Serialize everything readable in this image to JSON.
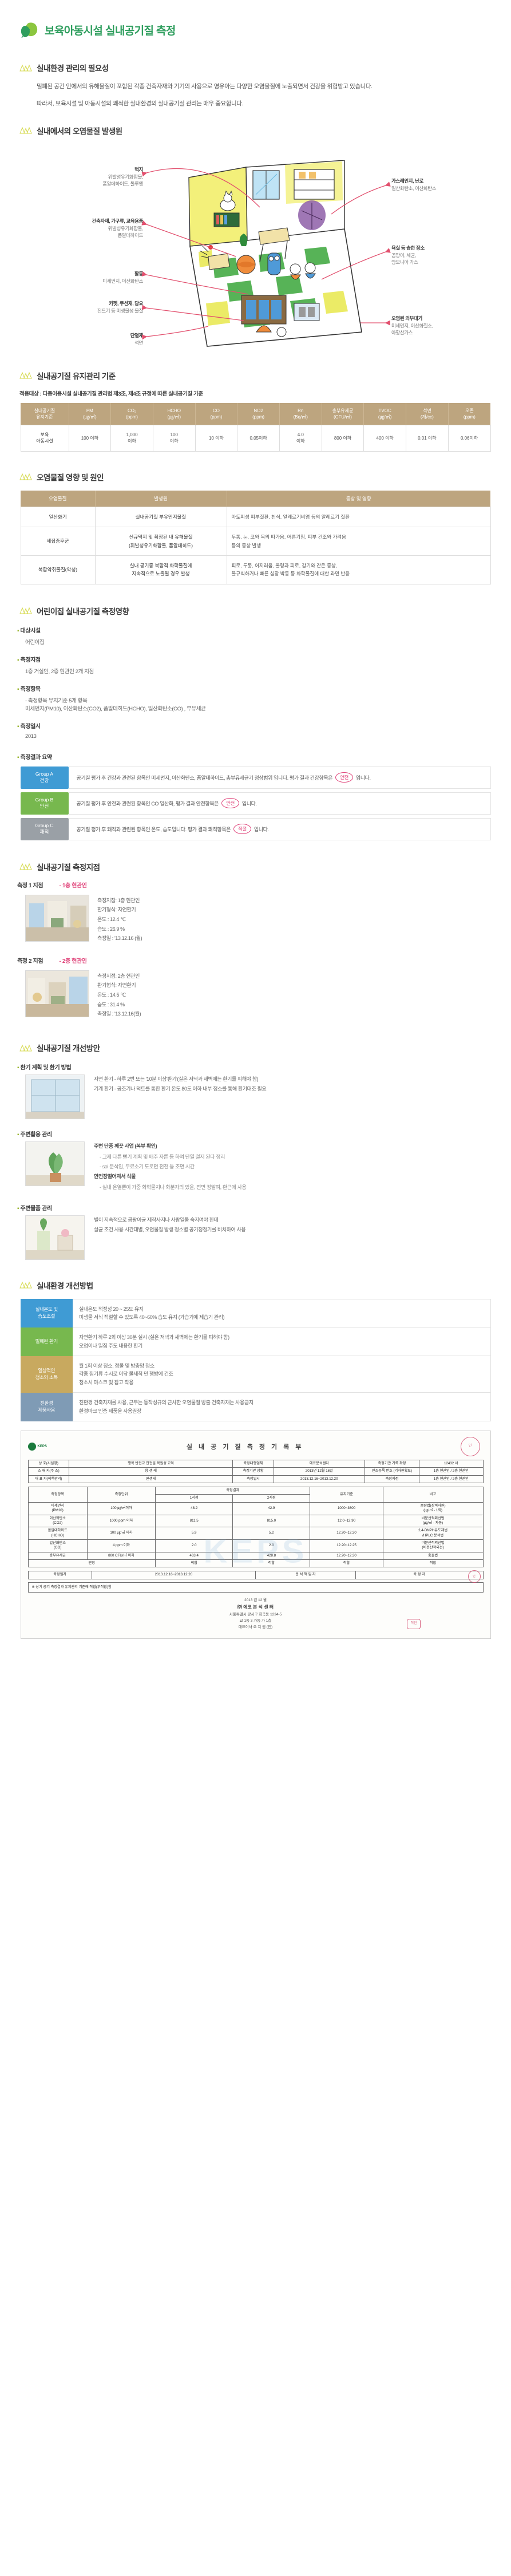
{
  "header": {
    "title": "보육아동시설 실내공기질 측정",
    "logo_icon": "leaf-logo"
  },
  "sections": {
    "necessity": {
      "title": "실내환경 관리의 필요성",
      "paragraphs": [
        "밀폐된 공간 안에서의 유해물질이 포함된 각종 건축자재와 기기의 사용으로 영유아는 다양한 오염물질에 노출되면서 건강을 위협받고 있습니다.",
        "따라서, 보육시설 및 아동시설의 쾌적한 실내환경의 실내공기질 관리는 매우 중요합니다."
      ]
    },
    "sources": {
      "title": "실내에서의 오염물질 발생원",
      "labels": [
        {
          "title": "벽지",
          "desc": "위발성유기화합물,\n폼알데하이드, 톨루엔"
        },
        {
          "title": "건축자재, 가구류, 교육용품",
          "desc": "위발성유기화합물,\n폼알데하이드"
        },
        {
          "title": "활동",
          "desc": "미세먼지, 이산화탄소"
        },
        {
          "title": "카펫, 쿠션재, 담요",
          "desc": "진드기 등 미생물성 물질"
        },
        {
          "title": "단열재",
          "desc": "석면"
        },
        {
          "title": "가스레인지, 난로",
          "desc": "일산화탄소, 이산화탄소"
        },
        {
          "title": "욕실 등 습한 장소",
          "desc": "곰팡이, 세균,\n암모니아 가스"
        },
        {
          "title": "오염된 외부대기",
          "desc": "미세먼지, 이산화질소,\n아황산가스"
        }
      ]
    },
    "standards": {
      "title": "실내공기질 유지관리 기준",
      "note": "적용대상 : 다중이용시설 실내공기질 관리법 제3조, 제4조 규정에 따른 실내공기질 기준",
      "columns": [
        {
          "name": "실내공기질\n유지기준",
          "unit": ""
        },
        {
          "name": "PM",
          "unit": "(㎍/㎥)"
        },
        {
          "name": "CO₂",
          "unit": "(ppm)"
        },
        {
          "name": "HCHO",
          "unit": "(㎍/㎥)"
        },
        {
          "name": "CO",
          "unit": "(ppm)"
        },
        {
          "name": "NO2",
          "unit": "(ppm)"
        },
        {
          "name": "Rn",
          "unit": "(Bq/㎥)"
        },
        {
          "name": "총부유세균",
          "unit": "(CFU/㎥)"
        },
        {
          "name": "TVOC",
          "unit": "(㎍/㎥)"
        },
        {
          "name": "석면",
          "unit": "(개/cc)"
        },
        {
          "name": "오존",
          "unit": "(ppm)"
        }
      ],
      "rows": [
        {
          "label": "보육\n아동시설",
          "values": [
            "100 이하",
            "1,000\n이하",
            "100\n이하",
            "10 이하",
            "0.05이하",
            "4.0\n이하",
            "800 이하",
            "400 이하",
            "0.01 이하",
            "0.06이하"
          ]
        }
      ]
    },
    "cause": {
      "title": "오염물질 영향 및 원인",
      "columns": [
        "오염물질",
        "발생원",
        "증상 및 영향"
      ],
      "rows": [
        {
          "name": "일산화기",
          "source": "실내공기질 부유먼지물질",
          "effect": "아토피성 피부질환, 천식, 알레르기비염 등의 알레르기 질환"
        },
        {
          "name": "세집증후군",
          "source": "신규택지 및 확장된 내 유해물질\n(휘발성유기화합물, 폼알데히드)",
          "effect": "두통, 눈, 코와 목의 따가움, 어른기침, 피부 건조와 가려움\n등의 증상 발생"
        },
        {
          "name": "복합악취물질(악성)",
          "source": "실내 공기중 복합적 화학물질에\n지속적으로 노출될 경우 발생",
          "effect": "피로, 두통, 어지러움, 울렁과 피로, 감기와 같은 증상,\n불규칙하거나 빠른 심장 박동 등 화학물질에 대한 과민 반응"
        }
      ]
    },
    "measurement_target": {
      "title": "어린이집 실내공기질 측정영향",
      "items": [
        {
          "label": "대상시설",
          "value": "어린이집"
        },
        {
          "label": "측정지점",
          "value": "1층 거실인, 2층 현관인  2개 지점"
        },
        {
          "label": "측정항목",
          "value": "- 측정항목 유지기준 5개 항목\n미세먼지(PM10), 이산화탄소(CO2), 폼알데히드(HCHO), 일산화탄소(CO) , 부유세균"
        },
        {
          "label": "측정일시",
          "value": "2013"
        }
      ],
      "summary_title": "측정결과 요약",
      "grades": [
        {
          "code": "Group A\n건강",
          "color": "#3f9bd4",
          "text_before": "공기질 평가 후 건강과 관련된 항목인 미세먼지, 이산화탄소, 폼알데하이드, 총부유세균기 정상범위 입니다.  평가 결과 건강항목은",
          "circle": "안전",
          "text_after": "입니다."
        },
        {
          "code": "Group B\n안전",
          "color": "#77b84e",
          "text_before": "공기질 평가 후 안전과 관련된 항목인 CO 일산화, 평가 결과 안전항목은",
          "circle": "안전",
          "text_after": "입니다."
        },
        {
          "code": "Group C\n쾌적",
          "color": "#9aa0a6",
          "text_before": "공기질 평가 후 쾌적과 관련된 항목인 온도, 습도입니다. 평가 결과 쾌적항목은",
          "circle": "적절",
          "text_after": "입니다."
        }
      ]
    },
    "points": {
      "title": "실내공기질 측정지점",
      "items": [
        {
          "head": "측정 1 지점",
          "tag": "- 1층 현관인",
          "lines": [
            "측정지점: 1층 현관인",
            "환기형식: 자연환기",
            "온도 : 12.4 ℃",
            "습도 : 26.9 %",
            "측정일 : '13.12.16 (월)"
          ]
        },
        {
          "head": "측정 2 지점",
          "tag": "- 2층 현관인",
          "lines": [
            "측정지점: 2층 현관인",
            "환기형식: 자연환기",
            "온도 : 14.5 ℃",
            "습도 : 31.4 %",
            "측정일 : '13.12.16(월)"
          ]
        }
      ]
    },
    "improvement": {
      "title": "실내공기질 개선방안",
      "groups": [
        {
          "head": "환기 계획 및 환기 방법",
          "lines": [
            "자연 환기 - 하루 2번 또는 '10분 이상'환기'(실온 저녁과 새벽에는 환기를 피해야 함)",
            "기계 환기 - 공조기나 덕트를 통한 환기 온도 80도 이하 내부 정소를 통해 환기대조 필요"
          ]
        },
        {
          "head": "주변활용 관리",
          "lines": [
            "주변 단풍 깨끗 사업 (복부 확인)",
            "- 그제 다른 뻗기 계획 및 매주 자른 등 하며 단열 철저 된다 정리",
            "- sol 분석임, 무료소기 도로면 천천 등 조면 시간",
            "안전장떨어져서 식물",
            "- 실내 온열뿐이 가중 화학물지나 화분자의 있을, 전면 정말며, 환근에 사용"
          ]
        },
        {
          "head": "주변물품 관리",
          "lines": [
            "별이 지속적으로 곰팡이균 제작사지나 사람일물 숙지여야 한데",
            "살균 조건 사용 시간대별, 오염물질 발생 정소별 공기청정기를 비치하여 사용"
          ]
        }
      ]
    },
    "plan": {
      "title": "실내환경 개선방법",
      "rows": [
        {
          "key": "실내온도 및\n습도조절",
          "color": "#3f9bd4",
          "text": "실내온도 적정성 20 ~ 25도 유지\n미생물 서식 적절할 수 있도록 40~60% 습도 유지 (가습기에 제습기 관리)"
        },
        {
          "key": "밀폐된 환기",
          "color": "#77b84e",
          "text": "자연환기 하루 2회 이상 30분 실시 (실온 저녁과 새벽에는 환기를 피해야 함)\n오염이나 밀집 주도 내용한 환기"
        },
        {
          "key": "일상적인\n청소와 소독",
          "color": "#c8a95f",
          "text": "월 1회 이상 청소, 정물 및 방충망 청소\n각종 집기류 수시로 이닦 물세척 민 행방에 건조\n청소시 마스크 및 잡고 착용"
        },
        {
          "key": "친환경\n제품사용",
          "color": "#7f9bb5",
          "text": "친환경 건축자재를 사용, 근무는 동작성규의 근사한 오염물질 방출 건축자재는 사용금지\n환경마크 인증 제품을 사용권장"
        }
      ]
    }
  },
  "report": {
    "title": "실 내 공 기 질  측 정 기 록 부",
    "logo_text": "KEPS",
    "watermark": "KEPS",
    "labels": {
      "site": "상  호(시설명)",
      "addr": "소 재 지(주 소)",
      "rep": "대 표 자(직책관리)",
      "meas_agency": "측정대행업체",
      "meas_cond": "측정기관 상황",
      "meas_date": "측정일시",
      "meas_point": "측정지점",
      "result": "측정결과",
      "date_label": "측정일자",
      "signature": "분 석 책 임 자",
      "confirm": "측 정 자",
      "conclusion": "※ 상기 공기 측정결과 유지관리 기준에 적합(부적합)함",
      "footer_title": "㈜ 에코 분 석 센 터",
      "footer_addr": "서울특별시 강서구 화곡동 1234-5\n교 1동 3 가동 가 1층\n대표이사   오 치 원   (인)",
      "footer_date": "2013  년        12  월"
    },
    "values": {
      "site": "행복 반전교 안전을 복원성 교육",
      "addr": "양 생 래",
      "rep": "원생태",
      "meas_agency": "에코분석센터",
      "meas_agency_sub": "측정기관 기록 확정",
      "biz_no": "12432 사",
      "biz_no_sub": "인조등록 번호 (기자원확보)",
      "meas_date_val": "2013년 12월 16일",
      "meas_point_val": "1층 현관인 / 2층 현관인",
      "period": "2013.12.16~2013.12.20",
      "analyst": "분 석 책 임 자",
      "tester": "측 정 자"
    },
    "table_headers": [
      "측정항목",
      "측정단위",
      "측정결과",
      "측정결과",
      "유지기준",
      "비고"
    ],
    "sub_headers": [
      "1지점",
      "2지점"
    ],
    "rows": [
      {
        "item": "미세먼지\n(PM10)",
        "unit": "100 ㎍/㎥이하",
        "v1": "48.2",
        "v2": "42.9",
        "std": "1000~3600",
        "note": "중량법(장비자원)\n(㎍/㎥ - 1회)"
      },
      {
        "item": "이산화탄소\n(CO2)",
        "unit": "1000 ppm 이하",
        "v1": "811.5",
        "v2": "815.0",
        "std": "12.0~12.90",
        "note": "비분산적외선법\n(㎍/㎥ - 자동)"
      },
      {
        "item": "폼알데하이드\n(HCHO)",
        "unit": "100 ㎍/㎥ 이하",
        "v1": "5.9",
        "v2": "5.2",
        "std": "12.20~12.30",
        "note": "2,4-DNPH유도체법\n/HPLC 분석법"
      },
      {
        "item": "일산화탄소\n(CO)",
        "unit": "4 ppm 이하",
        "v1": "2.0",
        "v2": "2.0",
        "std": "12.20~12.25",
        "note": "비분산적외선법\n(비분산적외선)"
      },
      {
        "item": "총부유세균",
        "unit": "800 CFU/㎥ 이하",
        "v1": "463.4",
        "v2": "428.8",
        "std": "12.20~12.30",
        "note": "충돌법"
      }
    ],
    "judgement_row": {
      "label": "판정",
      "values": [
        "적합",
        "적합",
        "적합",
        "적합"
      ]
    }
  }
}
